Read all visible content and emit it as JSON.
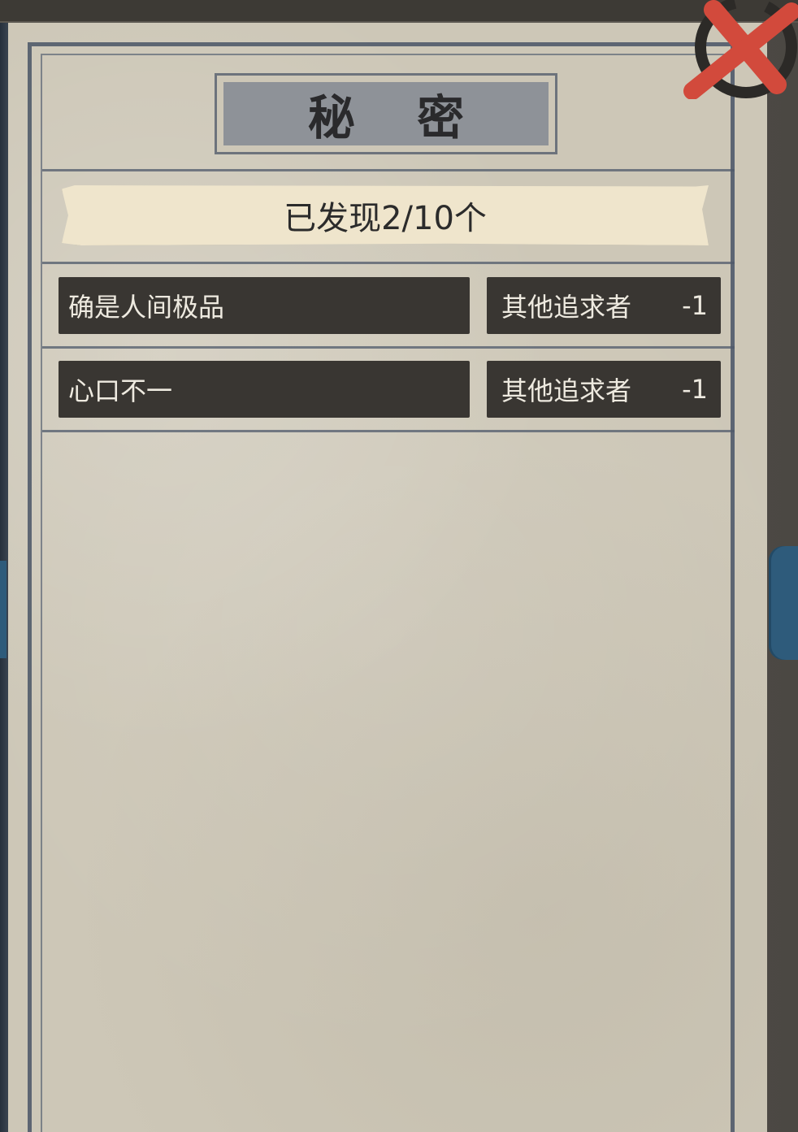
{
  "panel": {
    "title": "秘 密",
    "found_summary": "已发现2/10个"
  },
  "secrets": [
    {
      "name": "确是人间极品",
      "effect_target": "其他追求者",
      "effect_value": "-1"
    },
    {
      "name": "心口不一",
      "effect_target": "其他追求者",
      "effect_value": "-1"
    }
  ],
  "icons": {
    "close": "close-icon"
  },
  "colors": {
    "paper": "#cdc7b7",
    "row_background": "#393632",
    "close_red": "#d24a3c",
    "banner": "#efe5cc",
    "side_tab": "#2e5b7b"
  }
}
